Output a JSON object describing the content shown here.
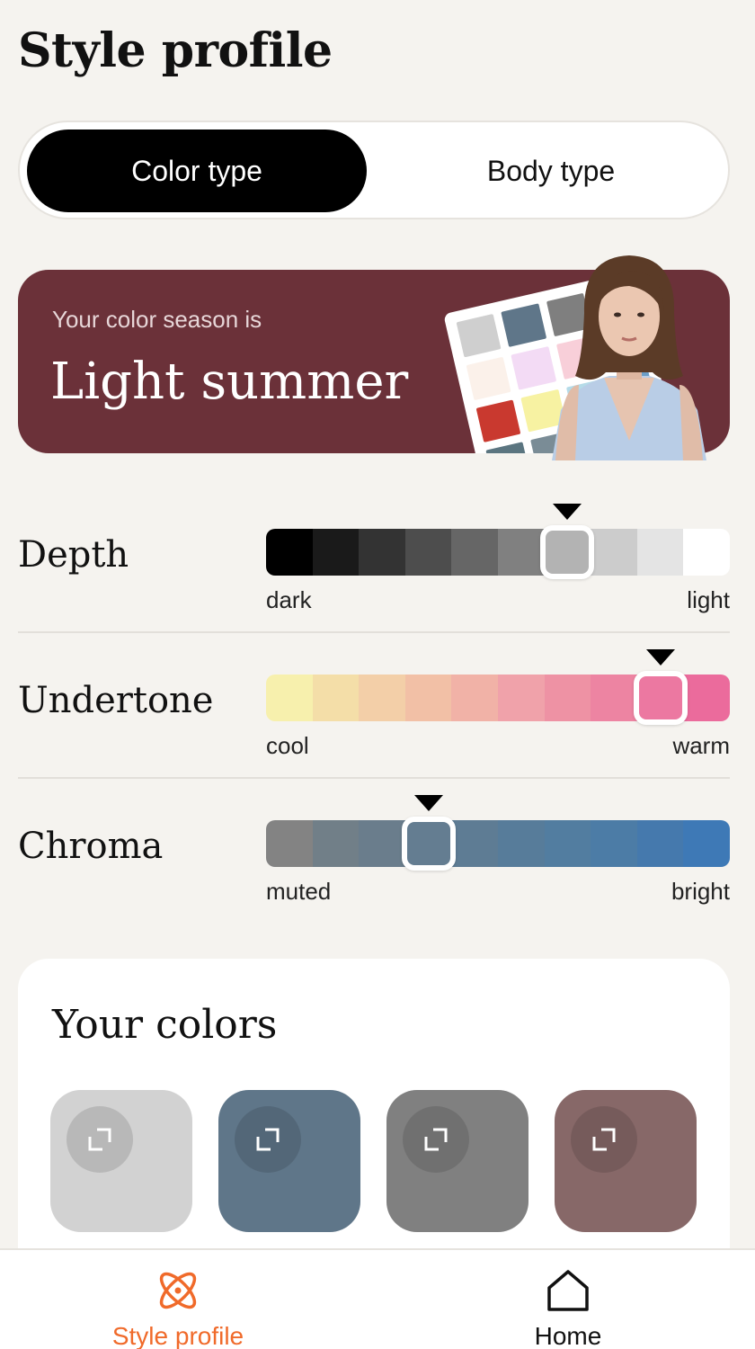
{
  "page": {
    "title": "Style profile"
  },
  "segmented": {
    "active_label": "Color type",
    "inactive_label": "Body type"
  },
  "season": {
    "subtitle": "Your color season is",
    "name": "Light summer",
    "palette": [
      "#cfcfcf",
      "#5f7689",
      "#7f7f7f",
      "#ececec",
      "#fbf1ea",
      "#f3dbf5",
      "#f8cfd9",
      "#d6ecf2",
      "#c9392f",
      "#f7f2a2",
      "#b5dbe8",
      "#6b9ec7",
      "#5b7580",
      "#7a8c96",
      "#a9a9a9",
      "#e7d7c6"
    ]
  },
  "scales": [
    {
      "label": "Depth",
      "left_label": "dark",
      "right_label": "light",
      "colors": [
        "#000000",
        "#1a1a1a",
        "#333333",
        "#4d4d4d",
        "#666666",
        "#808080",
        "#b3b3b3",
        "#cccccc",
        "#e4e4e4",
        "#ffffff"
      ],
      "selected_index": 6
    },
    {
      "label": "Undertone",
      "left_label": "cool",
      "right_label": "warm",
      "colors": [
        "#f7f0ad",
        "#f4dea8",
        "#f3cfa8",
        "#f2c0a6",
        "#f1b2a7",
        "#f0a2aa",
        "#ee92a4",
        "#ed84a2",
        "#ec78a1",
        "#eb6b9c"
      ],
      "selected_index": 8
    },
    {
      "label": "Chroma",
      "left_label": "muted",
      "right_label": "bright",
      "colors": [
        "#838383",
        "#717f88",
        "#6a7d8c",
        "#647d91",
        "#5e7c94",
        "#577c9a",
        "#527da0",
        "#4c7ca6",
        "#4579ad",
        "#3e79b6"
      ],
      "selected_index": 3
    }
  ],
  "your_colors": {
    "title": "Your colors",
    "tiles": [
      {
        "color": "#d2d2d2",
        "icon": "expand-icon"
      },
      {
        "color": "#5f7689",
        "icon": "expand-icon"
      },
      {
        "color": "#808080",
        "icon": "expand-icon"
      },
      {
        "color": "#876868",
        "icon": "expand-icon"
      }
    ]
  },
  "tabs": [
    {
      "label": "Style profile",
      "icon": "atom-icon",
      "color": "#f06a2a",
      "active": true
    },
    {
      "label": "Home",
      "icon": "home-icon",
      "color": "#111111",
      "active": false
    }
  ]
}
